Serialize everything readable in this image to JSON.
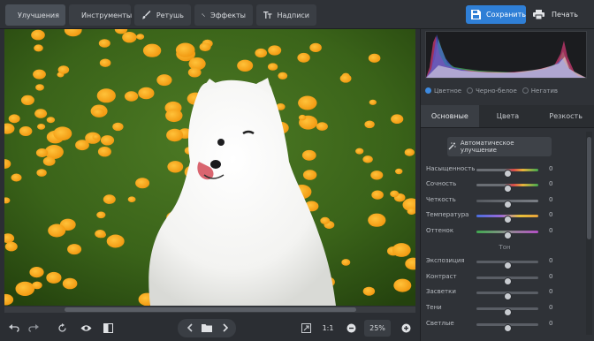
{
  "toolbar": {
    "tabs": [
      {
        "label": "Улучшения",
        "icon": "sliders-icon"
      },
      {
        "label": "Инструменты",
        "icon": "crop-icon"
      },
      {
        "label": "Ретушь",
        "icon": "brush-icon"
      },
      {
        "label": "Эффекты",
        "icon": "magic-wand-icon"
      },
      {
        "label": "Надписи",
        "icon": "text-icon"
      }
    ],
    "active_tab": "Улучшения",
    "save_label": "Сохранить",
    "print_label": "Печать"
  },
  "bottombar": {
    "zoom_fit_label": "1:1",
    "zoom_value": "25%"
  },
  "panel": {
    "color_modes": [
      "Цветное",
      "Черно-белое",
      "Негатив"
    ],
    "selected_mode": "Цветное",
    "tabs": [
      "Основные",
      "Цвета",
      "Резкость"
    ],
    "active_tab": "Основные",
    "auto_button": "Автоматическое улучшение",
    "color_sliders": [
      {
        "label": "Насыщенность",
        "value": "0",
        "position": 0.5
      },
      {
        "label": "Сочность",
        "value": "0",
        "position": 0.5
      },
      {
        "label": "Четкость",
        "value": "0",
        "position": 0.5
      },
      {
        "label": "Температура",
        "value": "0",
        "position": 0.5
      },
      {
        "label": "Оттенок",
        "value": "0",
        "position": 0.5
      }
    ],
    "tone_title": "Тон",
    "tone_sliders": [
      {
        "label": "Экспозиция",
        "value": "0",
        "position": 0.5
      },
      {
        "label": "Контраст",
        "value": "0",
        "position": 0.5
      },
      {
        "label": "Засветки",
        "value": "0",
        "position": 0.5
      },
      {
        "label": "Тени",
        "value": "0",
        "position": 0.5
      },
      {
        "label": "Светлые",
        "value": "0",
        "position": 0.5
      }
    ]
  },
  "colors": {
    "accent": "#2f7fd6",
    "panel_bg": "#2f3237"
  }
}
